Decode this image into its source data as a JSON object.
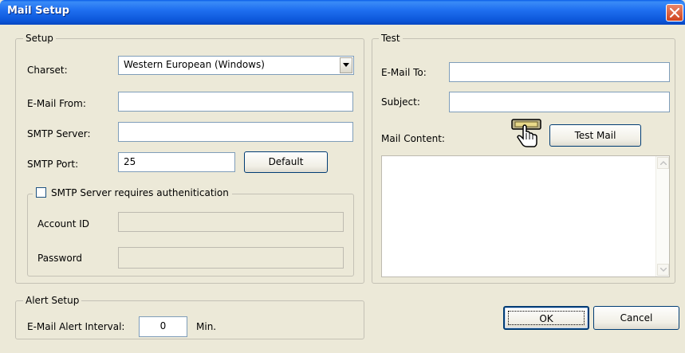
{
  "window": {
    "title": "Mail Setup"
  },
  "setup": {
    "legend": "Setup",
    "charset_label": "Charset:",
    "charset_value": "Western European (Windows)",
    "email_from_label": "E-Mail From:",
    "email_from_value": "",
    "smtp_server_label": "SMTP Server:",
    "smtp_server_value": "",
    "smtp_port_label": "SMTP Port:",
    "smtp_port_value": "25",
    "default_button": "Default",
    "auth_checkbox_label": "SMTP Server requires authenitication",
    "auth_checked": false,
    "account_id_label": "Account ID",
    "account_id_value": "",
    "password_label": "Password",
    "password_value": ""
  },
  "test": {
    "legend": "Test",
    "email_to_label": "E-Mail To:",
    "email_to_value": "",
    "subject_label": "Subject:",
    "subject_value": "",
    "mail_content_label": "Mail Content:",
    "test_mail_button": "Test Mail",
    "mail_content_value": ""
  },
  "alert": {
    "legend": "Alert Setup",
    "interval_label": "E-Mail Alert Interval:",
    "interval_value": "0",
    "interval_unit": "Min."
  },
  "footer": {
    "ok_button": "OK",
    "cancel_button": "Cancel"
  }
}
